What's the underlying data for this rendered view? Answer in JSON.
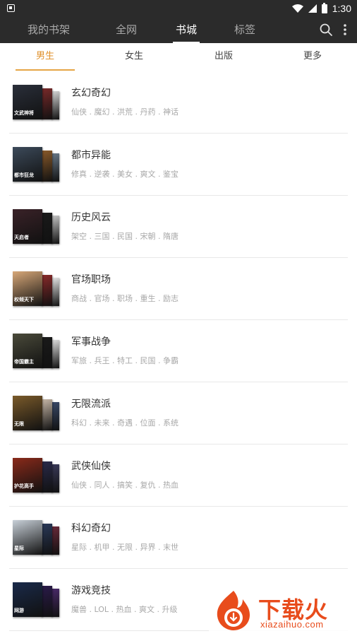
{
  "status_bar": {
    "time": "1:30"
  },
  "toolbar": {
    "tabs": [
      {
        "label": "我的书架"
      },
      {
        "label": "全网"
      },
      {
        "label": "书城"
      },
      {
        "label": "标签"
      }
    ],
    "active_tab": "书城"
  },
  "subtabs": {
    "items": [
      {
        "label": "男生"
      },
      {
        "label": "女生"
      },
      {
        "label": "出版"
      },
      {
        "label": "更多"
      }
    ],
    "active": "男生",
    "accent_color": "#e0912c"
  },
  "categories": [
    {
      "title": "玄幻奇幻",
      "tags": "仙侠 . 魔幻 . 洪荒 . 丹药 . 神话",
      "cover_caption": "文武神将"
    },
    {
      "title": "都市异能",
      "tags": "修真 . 逆袭 . 美女 . 爽文 . 鉴宝",
      "cover_caption": "都市狂龙"
    },
    {
      "title": "历史风云",
      "tags": "架空 . 三国 . 民国 . 宋朝 . 隋唐",
      "cover_caption": "天启者"
    },
    {
      "title": "官场职场",
      "tags": "商战 . 官场 . 职场 . 重生 . 励志",
      "cover_caption": "权倾天下"
    },
    {
      "title": "军事战争",
      "tags": "军旅 . 兵王 . 特工 . 民国 . 争霸",
      "cover_caption": "帝国霸主"
    },
    {
      "title": "无限流派",
      "tags": "科幻 . 未来 . 奇遇 . 位面 . 系统",
      "cover_caption": "无限"
    },
    {
      "title": "武侠仙侠",
      "tags": "仙侠 . 同人 . 搞笑 . 复仇 . 热血",
      "cover_caption": "护花高手"
    },
    {
      "title": "科幻奇幻",
      "tags": "星际 . 机甲 . 无限 . 异界 . 末世",
      "cover_caption": "星际"
    },
    {
      "title": "游戏竞技",
      "tags": "魔兽 . LOL . 热血 . 爽文 . 升级",
      "cover_caption": "网游"
    }
  ],
  "cover_colors": [
    [
      "#2a2f3a",
      "#7a2a2a",
      "#d8d8d8"
    ],
    [
      "#3c4a5a",
      "#8a5a2a",
      "#6a7a8a"
    ],
    [
      "#3a2228",
      "#1a1a1a",
      "#c8c8c8"
    ],
    [
      "#d8a878",
      "#8a2a2a",
      "#e8e8e8"
    ],
    [
      "#4a4a3a",
      "#1a1a1a",
      "#e0e0e0"
    ],
    [
      "#7a5a2a",
      "#c8b8a8",
      "#3a4a6a"
    ],
    [
      "#8a2a1a",
      "#2a2a4a",
      "#3a3a5a"
    ],
    [
      "#c8d0d8",
      "#2a3a5a",
      "#6a2a3a"
    ],
    [
      "#1a2a4a",
      "#2a1a4a",
      "#4a2a6a"
    ]
  ],
  "watermark": {
    "text": "下载火",
    "url": "xiazaihuo.com",
    "color": "#e84c1c"
  }
}
